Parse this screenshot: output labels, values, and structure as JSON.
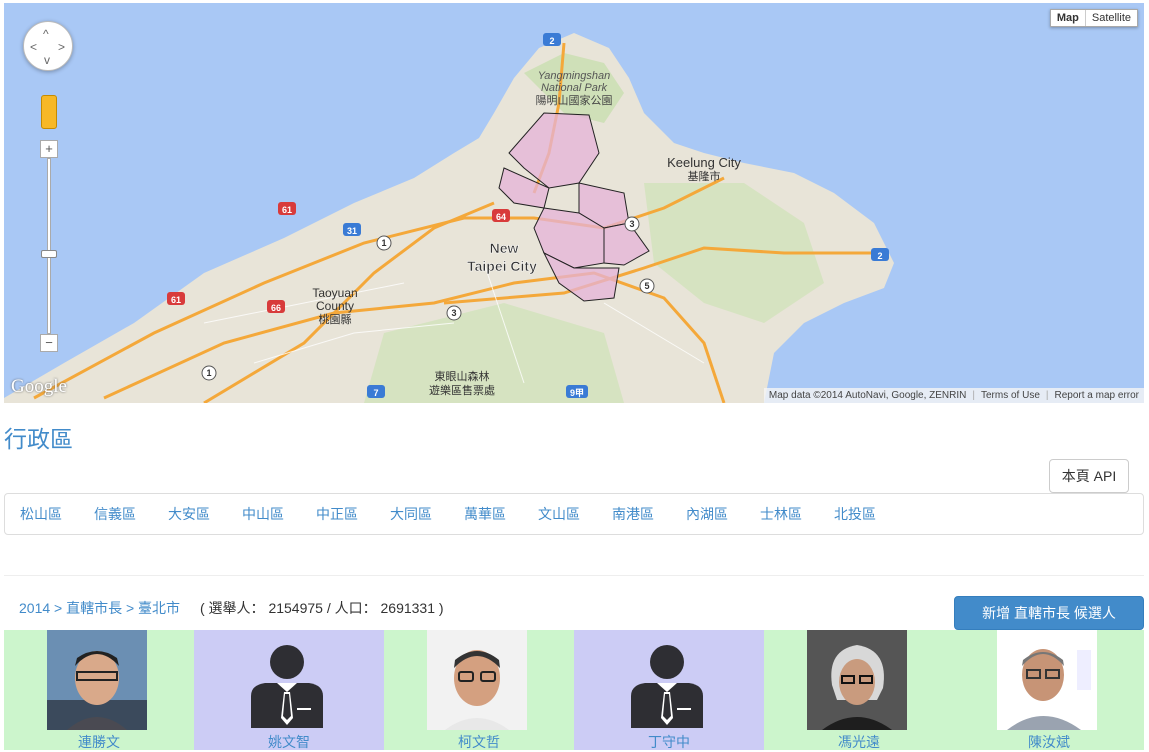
{
  "map": {
    "type_buttons": [
      "Map",
      "Satellite"
    ],
    "active_type": "Map",
    "pan_arrows": [
      "^",
      "<",
      ">",
      "v"
    ],
    "zoom_in": "+",
    "zoom_out": "−",
    "logo": "Google",
    "labels": {
      "yangmingshan_en1": "Yangmingshan",
      "yangmingshan_en2": "National Park",
      "yangmingshan_zh": "陽明山國家公園",
      "keelung_en": "Keelung City",
      "keelung_zh": "基隆市",
      "newtaipei1": "New",
      "newtaipei2": "Taipei City",
      "taoyuan1": "Taoyuan",
      "taoyuan2": "County",
      "taoyuan_zh": "桃園縣",
      "forest1": "東眼山森林",
      "forest2": "遊樂區售票處"
    },
    "road_shields": [
      "2",
      "61",
      "64",
      "31",
      "1",
      "3",
      "5",
      "2",
      "61",
      "66",
      "3",
      "1",
      "7",
      "9甲"
    ],
    "attribution": [
      "Map data ©2014 AutoNavi, Google, ZENRIN",
      "Terms of Use",
      "Report a map error"
    ]
  },
  "page": {
    "title": "行政區",
    "api_button": "本頁 API"
  },
  "districts": [
    "松山區",
    "信義區",
    "大安區",
    "中山區",
    "中正區",
    "大同區",
    "萬華區",
    "文山區",
    "南港區",
    "內湖區",
    "士林區",
    "北投區"
  ],
  "election": {
    "breadcrumb": "2014 > 直轄市長 > 臺北市",
    "stats": "( 選舉人： 2154975 / 人口： 2691331 )",
    "add_button": "新增 直轄市長 候選人"
  },
  "candidates": [
    {
      "name": "連勝文",
      "bg": "#ccf5cc",
      "photo": "person-photo"
    },
    {
      "name": "姚文智",
      "bg": "#ccccf5",
      "photo": "placeholder-silhouette"
    },
    {
      "name": "柯文哲",
      "bg": "#ccf5cc",
      "photo": "person-photo"
    },
    {
      "name": "丁守中",
      "bg": "#ccccf5",
      "photo": "placeholder-silhouette"
    },
    {
      "name": "馮光遠",
      "bg": "#ccf5cc",
      "photo": "person-photo"
    },
    {
      "name": "陳汝斌",
      "bg": "#ccf5cc",
      "photo": "person-photo"
    }
  ]
}
